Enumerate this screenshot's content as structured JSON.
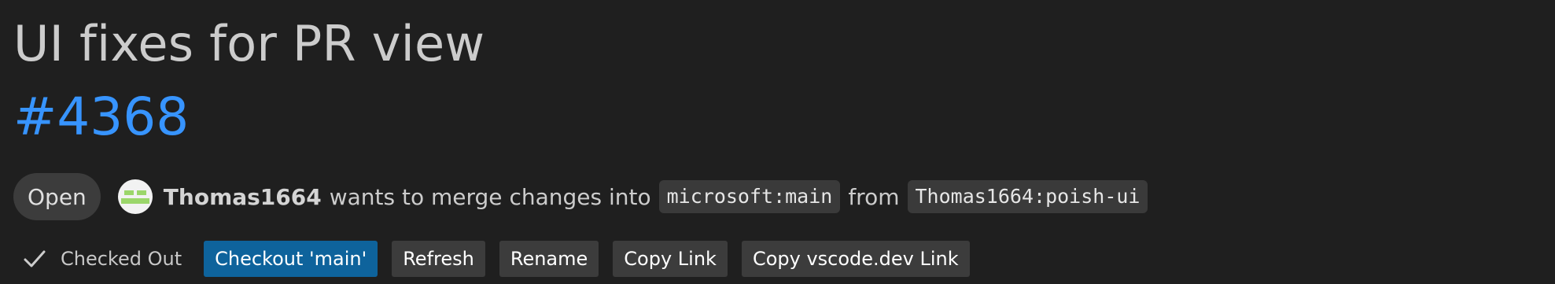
{
  "pr": {
    "title": "UI fixes for PR view",
    "number": "#4368",
    "status": "Open",
    "author": "Thomas1664",
    "merge_text": "wants to merge changes into",
    "base_branch": "microsoft:main",
    "from_text": "from",
    "head_branch": "Thomas1664:poish-ui"
  },
  "actions": {
    "checked_out_label": "Checked Out",
    "checkout_label": "Checkout 'main'",
    "refresh_label": "Refresh",
    "rename_label": "Rename",
    "copy_link_label": "Copy Link",
    "copy_vscode_label": "Copy vscode.dev Link"
  },
  "colors": {
    "background": "#1f1f1f",
    "link": "#3794ff",
    "primary_button": "#0e639c",
    "secondary_button": "#3c3c3c"
  },
  "icons": {
    "check": "check-icon",
    "avatar": "avatar"
  }
}
